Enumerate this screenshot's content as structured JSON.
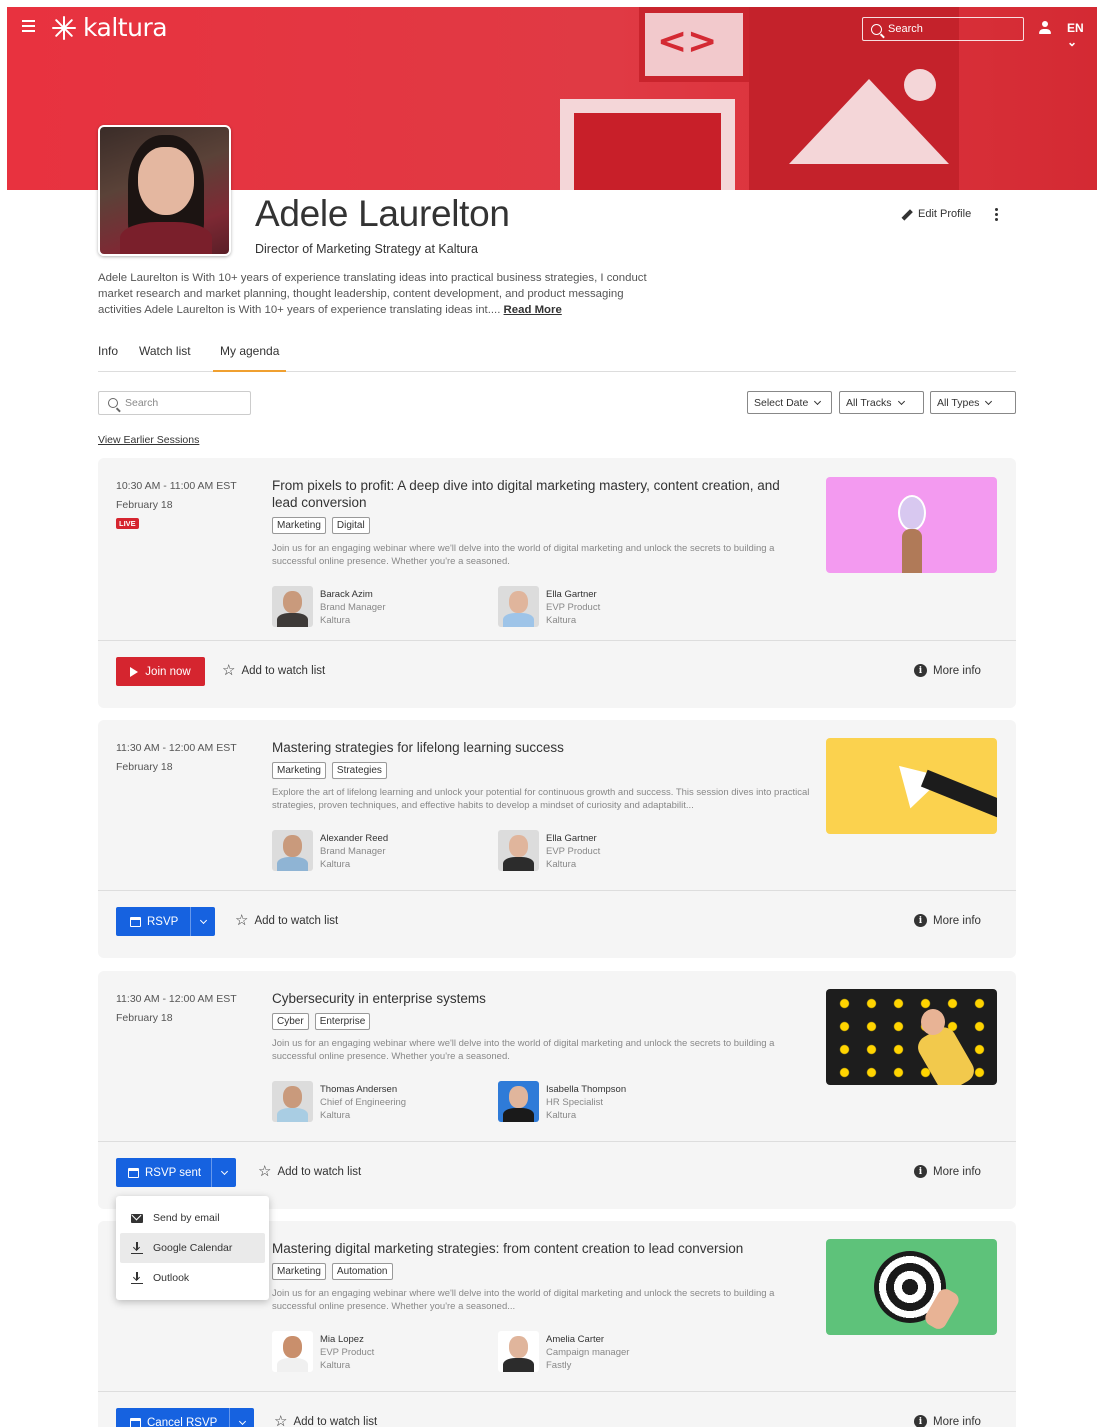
{
  "header": {
    "brand": "kaltura",
    "search_placeholder": "Search",
    "language": "EN"
  },
  "profile": {
    "name": "Adele Laurelton",
    "role": "Director of Marketing Strategy at Kaltura",
    "edit_label": "Edit Profile",
    "bio": "Adele Laurelton is With 10+ years of experience translating ideas into practical business strategies, I conduct market research and market planning, thought leadership, content development, and product messaging activities Adele Laurelton is With 10+ years of experience translating ideas int....",
    "read_more": "Read More"
  },
  "tabs": [
    {
      "label": "Info",
      "active": false
    },
    {
      "label": "Watch list",
      "active": false
    },
    {
      "label": "My agenda",
      "active": true
    }
  ],
  "filters": {
    "search_placeholder": "Search",
    "date": "Select Date",
    "tracks": "All Tracks",
    "types": "All Types",
    "view_earlier": "View Earlier Sessions"
  },
  "common": {
    "add_to_watch": "Add to watch list",
    "more_info": "More info",
    "live": "LIVE",
    "info_glyph": "i",
    "star_glyph": "☆"
  },
  "sessions": [
    {
      "time": "10:30 AM - 11:00 AM EST",
      "date": "February 18",
      "live": true,
      "title": "From pixels to profit: A deep dive into digital marketing mastery, content creation, and lead conversion",
      "tags": [
        "Marketing",
        "Digital"
      ],
      "description": "Join us for an engaging webinar where we'll delve into the world of digital marketing and unlock the secrets to building a successful online presence. Whether you're a seasoned.",
      "speakers": [
        {
          "name": "Barack Azim",
          "title": "Brand Manager",
          "company": "Kaltura"
        },
        {
          "name": "Ella Gartner",
          "title": "EVP Product",
          "company": "Kaltura"
        }
      ],
      "action": "Join now",
      "thumb_color": "#f39af0"
    },
    {
      "time": "11:30 AM - 12:00 AM EST",
      "date": "February 18",
      "title": "Mastering strategies for lifelong learning success",
      "tags": [
        "Marketing",
        "Strategies"
      ],
      "description": "Explore the art of lifelong learning and unlock your potential for continuous growth and success. This session dives into practical strategies, proven techniques, and effective habits to develop a mindset of curiosity and adaptabilit...",
      "speakers": [
        {
          "name": "Alexander Reed",
          "title": "Brand Manager",
          "company": "Kaltura"
        },
        {
          "name": "Ella Gartner",
          "title": "EVP Product",
          "company": "Kaltura"
        }
      ],
      "action": "RSVP",
      "thumb_color": "#fbd24e"
    },
    {
      "time": "11:30 AM - 12:00 AM EST",
      "date": "February 18",
      "title": "Cybersecurity in enterprise systems",
      "tags": [
        "Cyber",
        "Enterprise"
      ],
      "description": "Join us for an engaging webinar where we'll delve into the world of digital marketing and unlock the secrets to building a successful online presence. Whether you're a seasoned.",
      "speakers": [
        {
          "name": "Thomas Andersen",
          "title": "Chief of Engineering",
          "company": "Kaltura"
        },
        {
          "name": "Isabella Thompson",
          "title": "HR Specialist",
          "company": "Kaltura"
        }
      ],
      "action": "RSVP sent",
      "thumb_color": "#1d1d1d"
    },
    {
      "title": "Mastering digital marketing strategies: from content creation to lead conversion",
      "tags": [
        "Marketing",
        "Automation"
      ],
      "description": "Join us for an engaging webinar where we'll delve into the world of digital marketing and unlock the secrets to building a successful online presence. Whether you're a seasoned...",
      "speakers": [
        {
          "name": "Mia Lopez",
          "title": "EVP Product",
          "company": "Kaltura"
        },
        {
          "name": "Amelia Carter",
          "title": "Campaign manager",
          "company": "Fastly"
        }
      ],
      "action": "Cancel RSVP",
      "thumb_color": "#5ec27a"
    }
  ],
  "rsvp_menu": [
    {
      "label": "Send by email",
      "icon": "mail-icon"
    },
    {
      "label": "Google Calendar",
      "icon": "download-icon"
    },
    {
      "label": "Outlook",
      "icon": "download-icon"
    }
  ]
}
